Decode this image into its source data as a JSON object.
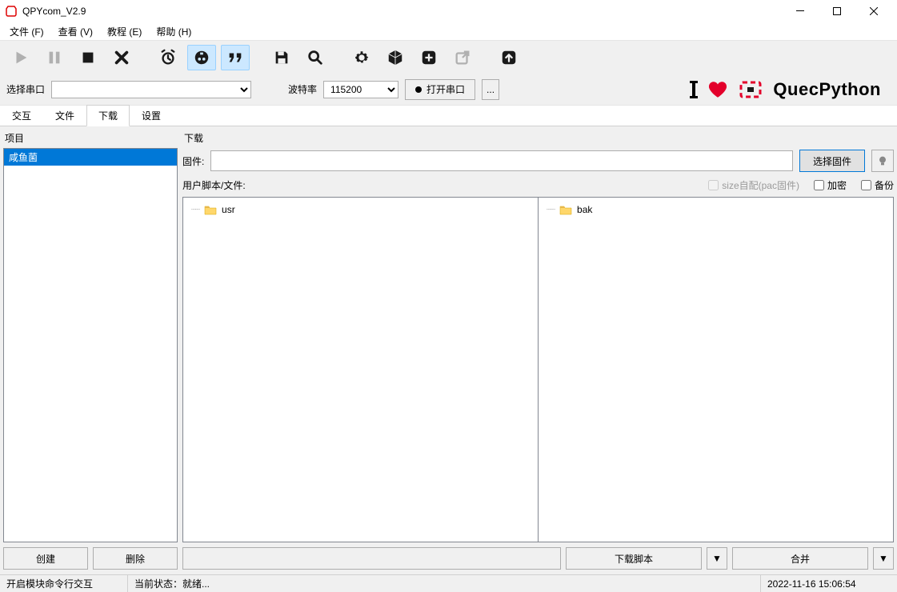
{
  "window": {
    "title": "QPYcom_V2.9"
  },
  "menu": {
    "file": "文件 (F)",
    "view": "查看 (V)",
    "tutorial": "教程 (E)",
    "help": "帮助 (H)"
  },
  "portbar": {
    "select_port_label": "选择串口",
    "baud_label": "波特率",
    "baud_value": "115200",
    "open_port_label": "打开串口",
    "more_label": "..."
  },
  "brand": {
    "text": "QuecPython"
  },
  "tabs": {
    "interact": "交互",
    "file": "文件",
    "download": "下载",
    "settings": "设置",
    "active": "download"
  },
  "left": {
    "group": "项目",
    "items": [
      "咸鱼菌"
    ],
    "create": "创建",
    "delete": "删除"
  },
  "right": {
    "group": "下载",
    "fw_label": "固件:",
    "fw_value": "",
    "select_fw": "选择固件",
    "script_label": "用户脚本/文件:",
    "size_auto": "size自配(pac固件)",
    "encrypt": "加密",
    "backup": "备份",
    "tree_left_root": "usr",
    "tree_right_root": "bak",
    "download_script": "下载脚本",
    "merge": "合并"
  },
  "status": {
    "left": "开启模块命令行交互",
    "mid": "当前状态：就绪...",
    "time": "2022-11-16 15:06:54"
  }
}
